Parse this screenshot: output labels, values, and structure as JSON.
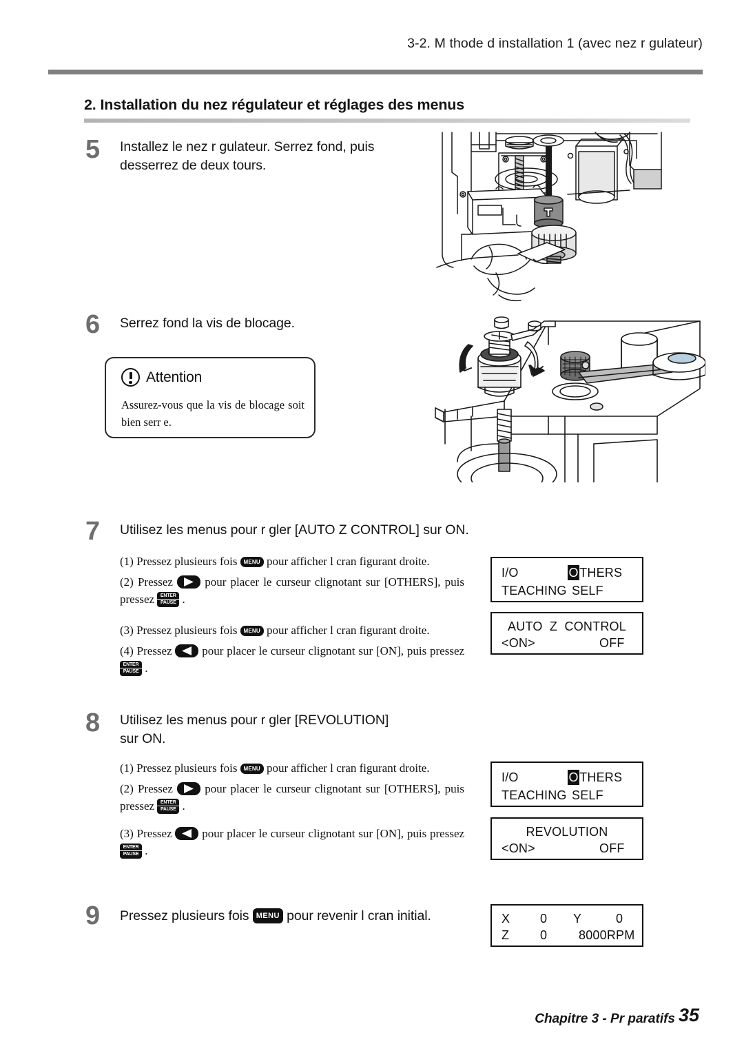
{
  "header": {
    "running_title": "3-2.  M thode d installation 1 (avec nez r gulateur)"
  },
  "section": {
    "title": "2. Installation du nez régulateur et réglages des menus"
  },
  "steps": [
    {
      "number": "5",
      "text": "Installez le nez r gulateur. Serrez    fond, puis desserrez de deux tours."
    },
    {
      "number": "6",
      "text": "Serrez    fond la vis de blocage."
    },
    {
      "number": "7",
      "text": "Utilisez les menus pour r gler [AUTO Z CONTROL] sur ON."
    },
    {
      "number": "8",
      "text_line1": "Utilisez les menus pour r gler [REVOLUTION]",
      "text_line2": "sur ON."
    },
    {
      "number": "9",
      "text_before": "Pressez plusieurs fois",
      "text_after": "pour revenir    l  cran initial."
    }
  ],
  "attention": {
    "title": "Attention",
    "body": "Assurez-vous que la vis de blocage soit bien serr  e."
  },
  "step7_items": [
    {
      "label": "(1)",
      "before": "Pressez plusieurs fois",
      "key": "MENU",
      "after": "pour afficher l  cran figurant    droite."
    },
    {
      "label": "(2)",
      "before": "Pressez",
      "key": "ARROW-RIGHT",
      "after": "pour placer le curseur clignotant sur [OTHERS], puis pressez",
      "key2": "ENTER-PAUSE",
      "tail": "."
    },
    {
      "label": "(3)",
      "before": "Pressez plusieurs fois",
      "key": "MENU",
      "after": "pour afficher l  cran figurant    droite."
    },
    {
      "label": "(4)",
      "before": "Pressez",
      "key": "ARROW-LEFT",
      "after": "pour placer le curseur clignotant sur [ON], puis pressez",
      "key2": "ENTER-PAUSE",
      "tail": "."
    }
  ],
  "step8_items": [
    {
      "label": "(1)",
      "before": "Pressez plusieurs fois",
      "key": "MENU",
      "after": "pour afficher l  cran figurant    droite."
    },
    {
      "label": "(2)",
      "before": "Pressez",
      "key": "ARROW-RIGHT",
      "after": "pour placer le curseur clignotant sur [OTHERS], puis pressez",
      "key2": "ENTER-PAUSE",
      "tail": "."
    },
    {
      "label": "(3)",
      "before": "Pressez",
      "key": "ARROW-LEFT",
      "after": "pour placer le curseur clignotant sur [ON], puis pressez",
      "key2": "ENTER-PAUSE",
      "tail": "."
    }
  ],
  "keys": {
    "menu_label": "MENU",
    "enter_line1": "ENTER",
    "enter_line2": "PAUSE"
  },
  "lcd_panels": {
    "menu_others_1": {
      "r1c1": "I/O",
      "r1c2_highlight": "O",
      "r1c2_rest": "THERS",
      "r2c1": "TEACHING",
      "r2c2": "SELF"
    },
    "auto_z_control": {
      "title": "AUTO  Z  CONTROL",
      "left": "<ON>",
      "right": "OFF"
    },
    "menu_others_2": {
      "r1c1": "I/O",
      "r1c2_highlight": "O",
      "r1c2_rest": "THERS",
      "r2c1": "TEACHING",
      "r2c2": "SELF"
    },
    "revolution": {
      "title": "REVOLUTION",
      "left": "<ON>",
      "right": "OFF"
    },
    "coordinates": {
      "x_label": "X",
      "x_value": "0",
      "y_label": "Y",
      "y_value": "0",
      "z_label": "Z",
      "z_value": "0",
      "spindle": "8000RPM"
    }
  },
  "footer": {
    "chapter": "Chapitre 3 - Pr paratifs",
    "page_number": "35"
  },
  "colors": {
    "rule_gray": "#808080",
    "step_number_gray": "#6e6e6e",
    "ink": "#111111"
  }
}
